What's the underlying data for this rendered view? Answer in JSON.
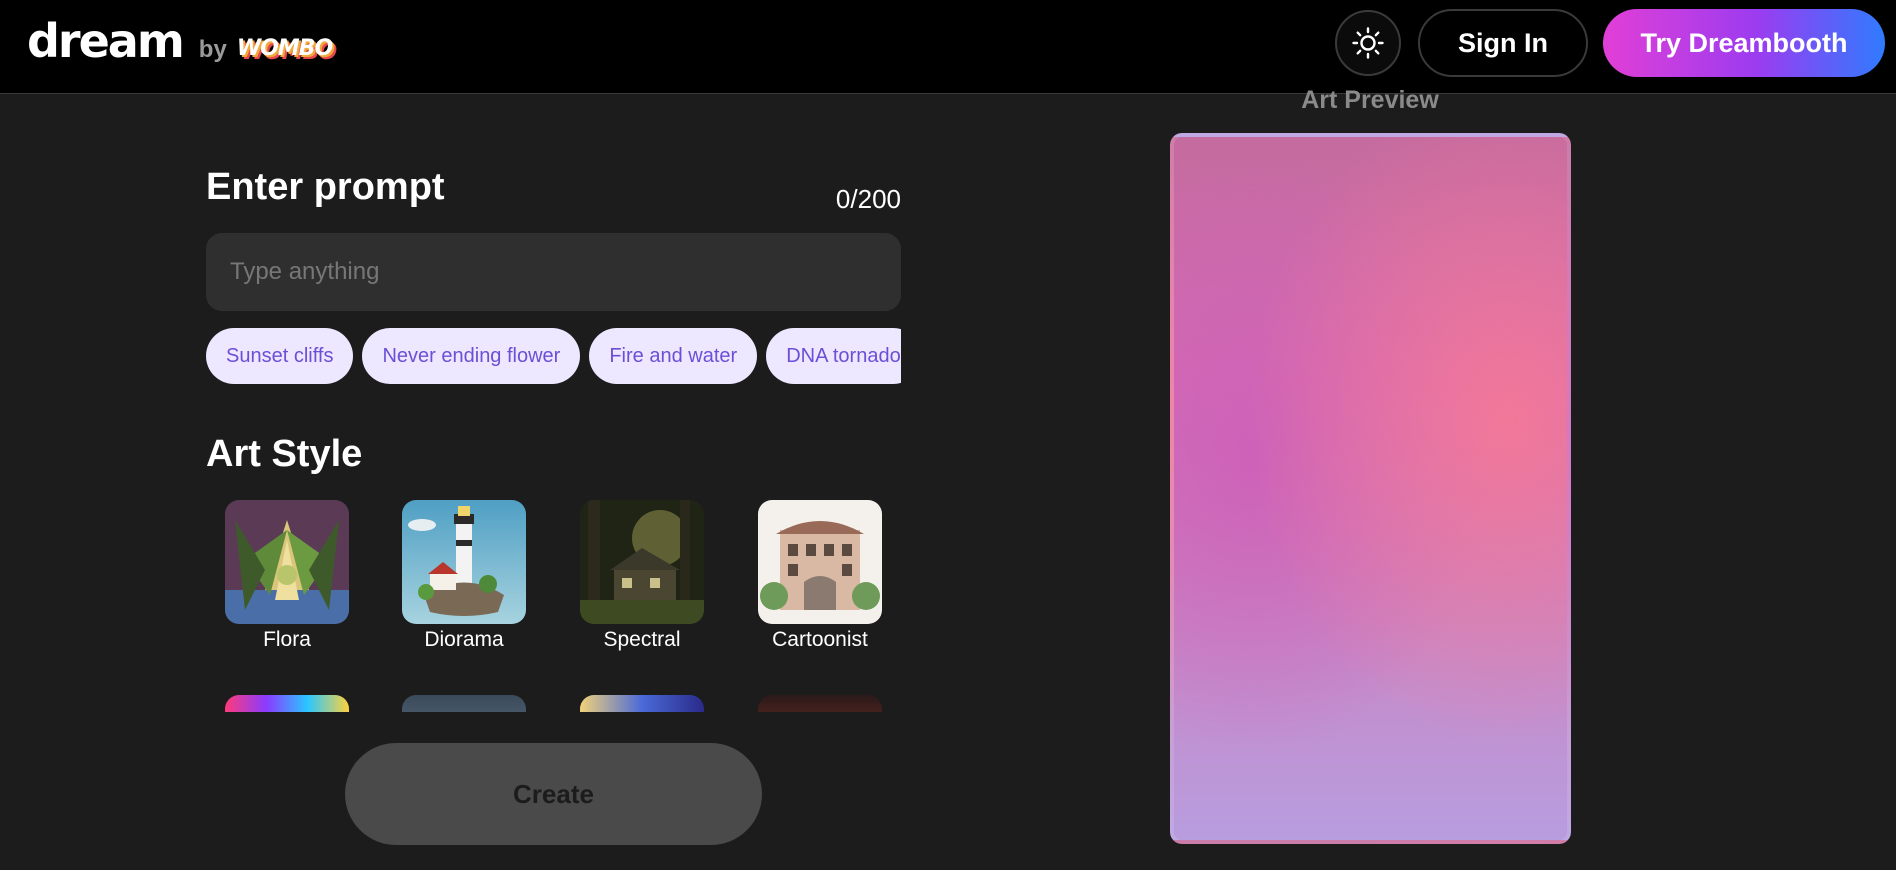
{
  "header": {
    "brand": "dream",
    "brand_by": "by",
    "brand_partner": "WOMBO",
    "theme_toggle_icon": "sun-icon",
    "sign_in_label": "Sign In",
    "dreambooth_label": "Try Dreambooth"
  },
  "prompt": {
    "title": "Enter prompt",
    "char_count": "0/200",
    "value": "",
    "placeholder": "Type anything",
    "suggestions": [
      "Sunset cliffs",
      "Never ending flower",
      "Fire and water",
      "DNA tornado"
    ]
  },
  "art_style": {
    "title": "Art Style",
    "styles": [
      "Flora",
      "Diorama",
      "Spectral",
      "Cartoonist"
    ]
  },
  "create_label": "Create",
  "preview": {
    "title": "Art Preview"
  },
  "colors": {
    "accent_gradient_start": "#e23fd6",
    "accent_gradient_end": "#2f7bff",
    "chip_bg": "#ede8ff",
    "chip_text": "#6b4fd6",
    "background": "#1c1c1c"
  }
}
